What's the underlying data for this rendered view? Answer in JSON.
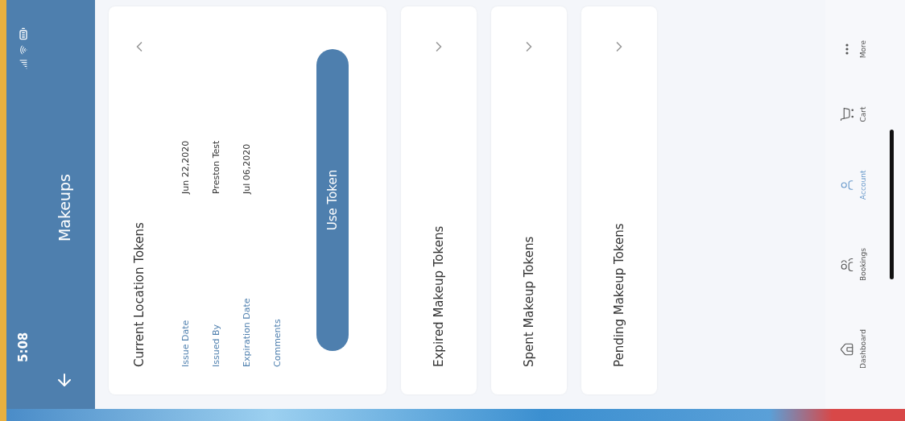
{
  "status_bar": {
    "time": "5:08"
  },
  "header": {
    "title": "Makeups"
  },
  "sections": [
    {
      "title": "Current Location Tokens",
      "expanded": true,
      "fields": [
        {
          "label": "Issue Date",
          "value": "Jun 22,2020"
        },
        {
          "label": "Issued By",
          "value": "Preston Test"
        },
        {
          "label": "Expiration Date",
          "value": "Jul 06,2020"
        },
        {
          "label": "Comments"
        }
      ],
      "button": "Use Token"
    },
    {
      "title": "Expired Makeup Tokens",
      "expanded": false
    },
    {
      "title": "Spent Makeup Tokens",
      "expanded": false
    },
    {
      "title": "Pending Makeup Tokens",
      "expanded": false
    }
  ],
  "tab_bar": [
    {
      "label": "Dashboard",
      "selected": false
    },
    {
      "label": "Bookings",
      "selected": false
    },
    {
      "label": "Account",
      "selected": true
    },
    {
      "label": "Cart",
      "selected": false
    },
    {
      "label": "More",
      "selected": false
    }
  ]
}
